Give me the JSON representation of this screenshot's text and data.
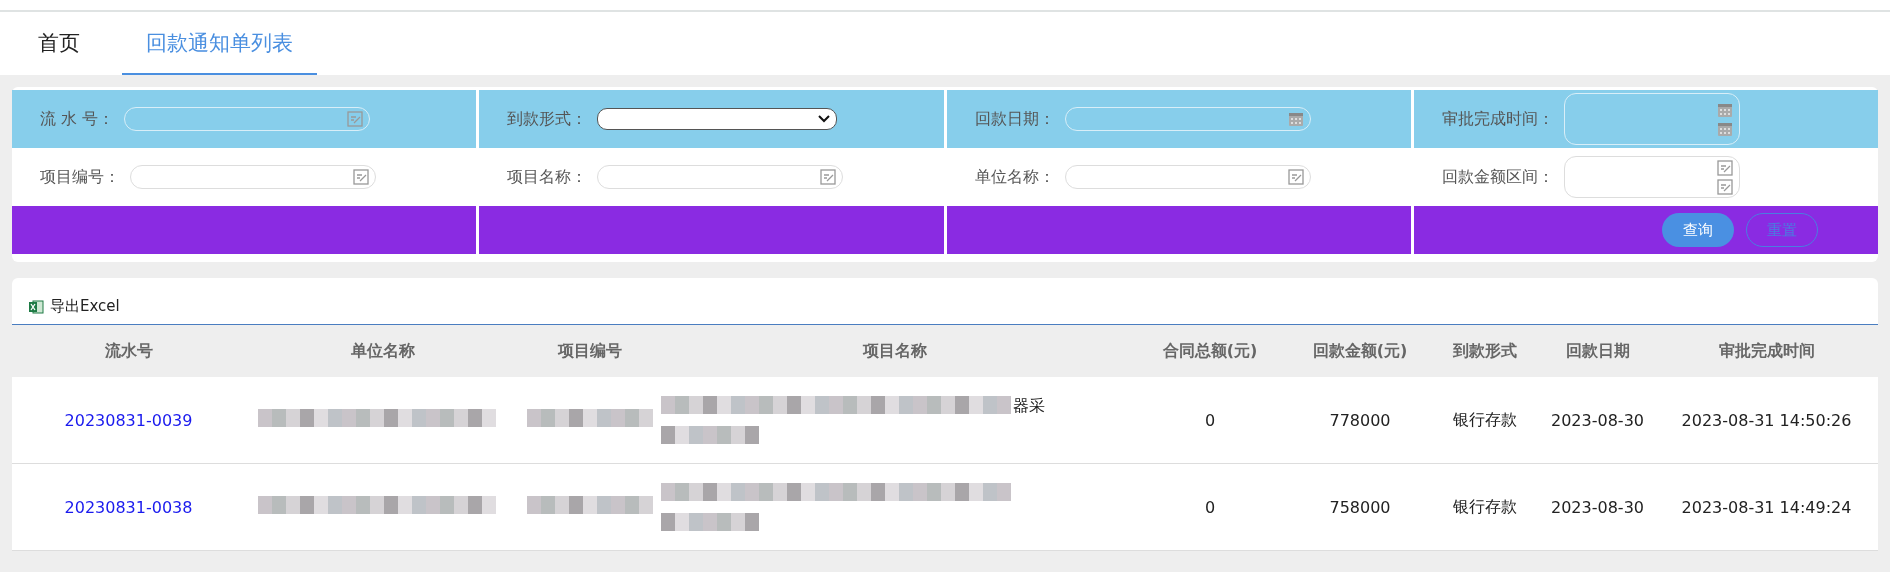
{
  "tabs": [
    {
      "label": "首页",
      "selected": false
    },
    {
      "label": "回款通知单列表",
      "selected": true
    }
  ],
  "filter_rows": [
    [
      {
        "label": "流 水 号：",
        "kind": "text"
      },
      {
        "label": "到款形式：",
        "kind": "select"
      },
      {
        "label": "回款日期：",
        "kind": "date"
      },
      {
        "label": "审批完成时间：",
        "kind": "date_range"
      }
    ],
    [
      {
        "label": "项目编号：",
        "kind": "text"
      },
      {
        "label": "项目名称：",
        "kind": "text"
      },
      {
        "label": "单位名称：",
        "kind": "text"
      },
      {
        "label": "回款金额区间：",
        "kind": "number_range"
      }
    ]
  ],
  "buttons": [
    {
      "label": "查询",
      "kind": "primary"
    },
    {
      "label": "重置",
      "kind": "outline"
    }
  ],
  "export_button": "导出Excel",
  "table": {
    "columns": [
      "流水号",
      "单位名称",
      "项目编号",
      "项目名称",
      "合同总额(元)",
      "回款金额(元)",
      "到款形式",
      "回款日期",
      "审批完成时间"
    ],
    "rows": [
      {
        "serial": "20230831-0039",
        "project_name_tail": "器采",
        "contract_total": "0",
        "amount": "778000",
        "method": "银行存款",
        "date": "2023-08-30",
        "approved": "2023-08-31 14:50:26"
      },
      {
        "serial": "20230831-0038",
        "project_name_tail": "",
        "contract_total": "0",
        "amount": "758000",
        "method": "银行存款",
        "date": "2023-08-30",
        "approved": "2023-08-31 14:49:24"
      }
    ]
  }
}
